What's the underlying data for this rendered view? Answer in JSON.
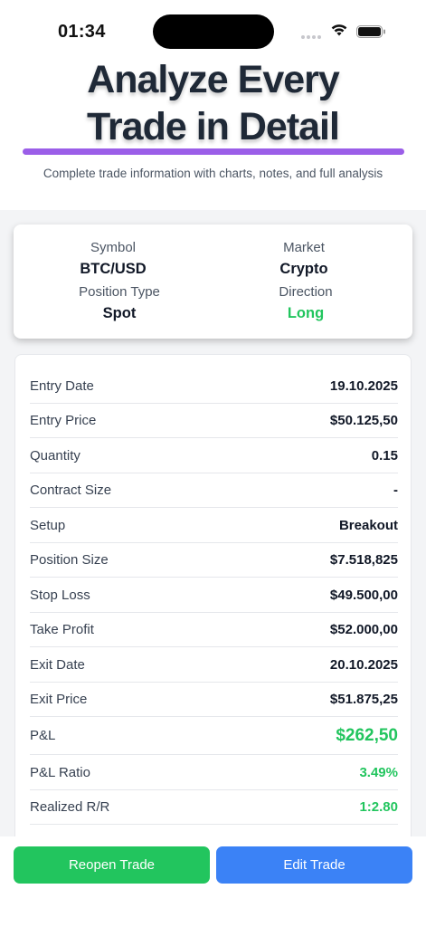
{
  "status_bar": {
    "time": "01:34"
  },
  "hero": {
    "title_line1": "Analyze Every",
    "title_line2": "Trade in Detail",
    "subtitle": "Complete trade information with charts, notes, and full analysis",
    "accent_color": "#9b5ee8"
  },
  "summary": {
    "symbol_label": "Symbol",
    "symbol_value": "BTC/USD",
    "market_label": "Market",
    "market_value": "Crypto",
    "position_type_label": "Position Type",
    "position_type_value": "Spot",
    "direction_label": "Direction",
    "direction_value": "Long"
  },
  "details": [
    {
      "label": "Entry Date",
      "value": "19.10.2025"
    },
    {
      "label": "Entry Price",
      "value": "$50.125,50"
    },
    {
      "label": "Quantity",
      "value": "0.15"
    },
    {
      "label": "Contract Size",
      "value": "-"
    },
    {
      "label": "Setup",
      "value": "Breakout"
    },
    {
      "label": "Position Size",
      "value": "$7.518,825"
    },
    {
      "label": "Stop Loss",
      "value": "$49.500,00"
    },
    {
      "label": "Take Profit",
      "value": "$52.000,00"
    },
    {
      "label": "Exit Date",
      "value": "20.10.2025"
    },
    {
      "label": "Exit Price",
      "value": "$51.875,25"
    },
    {
      "label": "P&L",
      "value": "$262,50"
    },
    {
      "label": "P&L Ratio",
      "value": "3.49%"
    },
    {
      "label": "Realized R/R",
      "value": "1:2.80"
    }
  ],
  "colors": {
    "positive": "#22c55e",
    "primary": "#3b82f6"
  },
  "actions": {
    "reopen_label": "Reopen Trade",
    "edit_label": "Edit Trade"
  }
}
